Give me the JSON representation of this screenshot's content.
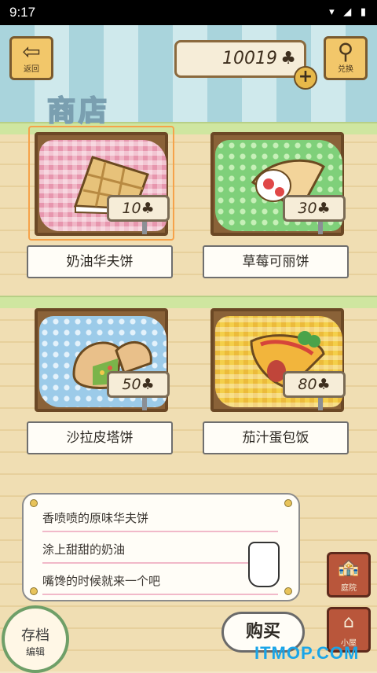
{
  "status_bar": {
    "time": "9:17",
    "icons": "▾ ◢ ▮"
  },
  "header": {
    "back_label": "返回",
    "back_glyph": "⇦",
    "currency_value": "10019",
    "currency_icon": "♣",
    "plus_label": "+",
    "exchange_label": "兑换",
    "exchange_glyph": "⚲",
    "title": "商店"
  },
  "items": [
    {
      "name": "奶油华夫饼",
      "price": "10♣",
      "cloth": "pink",
      "selected": true
    },
    {
      "name": "草莓可丽饼",
      "price": "30♣",
      "cloth": "green",
      "selected": false
    },
    {
      "name": "沙拉皮塔饼",
      "price": "50♣",
      "cloth": "blue",
      "selected": false
    },
    {
      "name": "茄汁蛋包饭",
      "price": "80♣",
      "cloth": "yellow",
      "selected": false
    }
  ],
  "description": {
    "lines": [
      "香喷喷的原味华夫饼",
      "涂上甜甜的奶油",
      "嘴馋的时候就来一个吧"
    ]
  },
  "side_buttons": {
    "yard_label": "庭院",
    "yard_glyph": "🏤",
    "house_label": "小屋",
    "house_glyph": "⌂"
  },
  "actions": {
    "buy_label": "购买",
    "save_label": "存档",
    "save_sub": "编辑"
  },
  "watermark": "ITMOP.COM",
  "colors": {
    "wall_stripe": "#a9d4dc",
    "wood": "#f0deb3",
    "accent_orange": "#f6a24a"
  }
}
